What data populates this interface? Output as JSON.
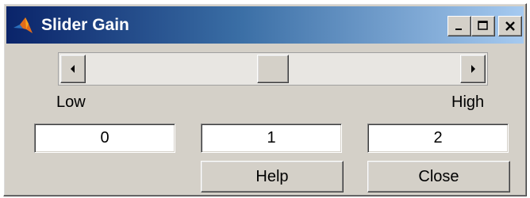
{
  "window": {
    "title": "Slider Gain",
    "titlebar_colors": [
      "#0a246a",
      "#a6caf0"
    ],
    "caption_buttons": [
      "minimize-icon",
      "maximize-icon",
      "close-icon"
    ]
  },
  "slider": {
    "left_arrow": "arrow-left-icon",
    "right_arrow": "arrow-right-icon",
    "value_fraction": 0.5
  },
  "labels": {
    "low": "Low",
    "high": "High"
  },
  "fields": {
    "min": "0",
    "value": "1",
    "max": "2"
  },
  "buttons": {
    "help": "Help",
    "close": "Close"
  }
}
